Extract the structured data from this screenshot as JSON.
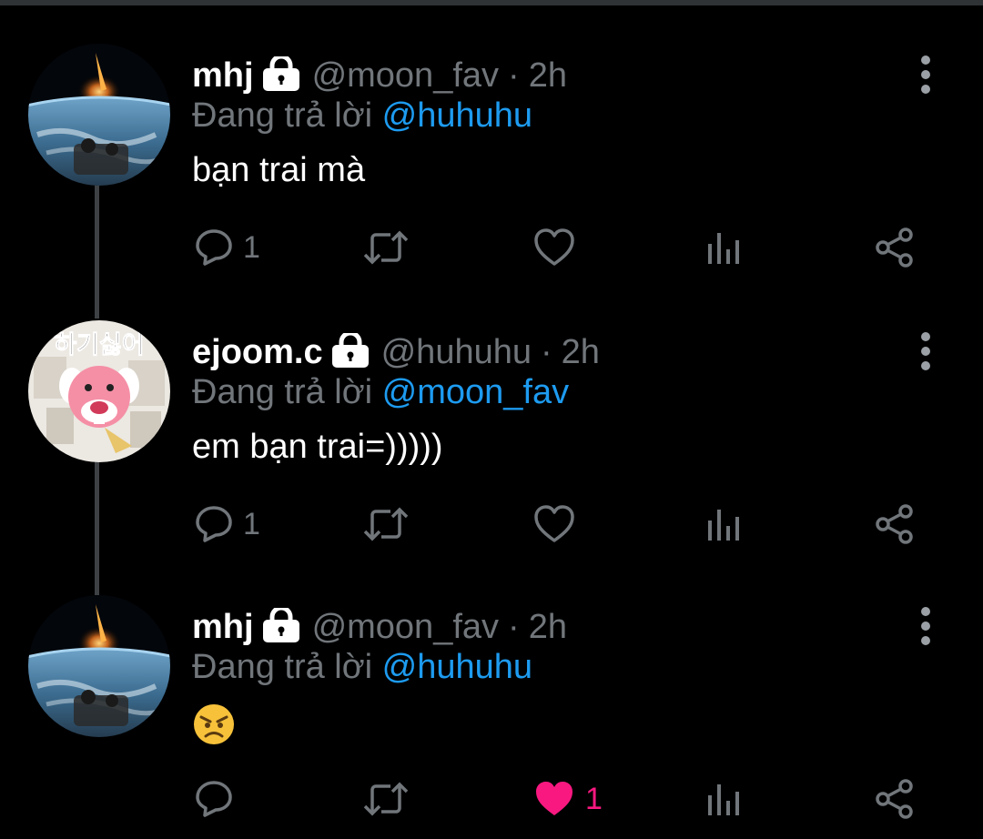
{
  "tweets": [
    {
      "name": "mhj",
      "handle": "@moon_fav",
      "separator": "·",
      "time": "2h",
      "reply_prefix": "Đang trả lời",
      "reply_to": "@huhuhu",
      "text": "bạn trai mà",
      "avatar": "earth-meteor-photo",
      "reply_count": "1",
      "like_count": "",
      "liked": false
    },
    {
      "name": "ejoom.c",
      "handle": "@huhuhu",
      "separator": "·",
      "time": "2h",
      "reply_prefix": "Đang trả lời",
      "reply_to": "@moon_fav",
      "text": "em bạn trai=)))))",
      "avatar": "crying-pink-beaver-sticker",
      "avatar_text": "하기싫어",
      "reply_count": "1",
      "like_count": "",
      "liked": false
    },
    {
      "name": "mhj",
      "handle": "@moon_fav",
      "separator": "·",
      "time": "2h",
      "reply_prefix": "Đang trả lời",
      "reply_to": "@huhuhu",
      "text": "",
      "emoji": "angry-face-emoji",
      "avatar": "earth-meteor-photo",
      "reply_count": "",
      "like_count": "1",
      "liked": true
    }
  ],
  "icons": {
    "lock": "lock-icon",
    "more": "more-vertical-icon",
    "reply": "reply-icon",
    "retweet": "retweet-icon",
    "like": "heart-icon",
    "views": "analytics-icon",
    "share": "share-icon"
  },
  "colors": {
    "background": "#000000",
    "text": "#ffffff",
    "muted": "#71767b",
    "link": "#1d9bf0",
    "like": "#f91880",
    "thread_line": "#3e4144"
  }
}
